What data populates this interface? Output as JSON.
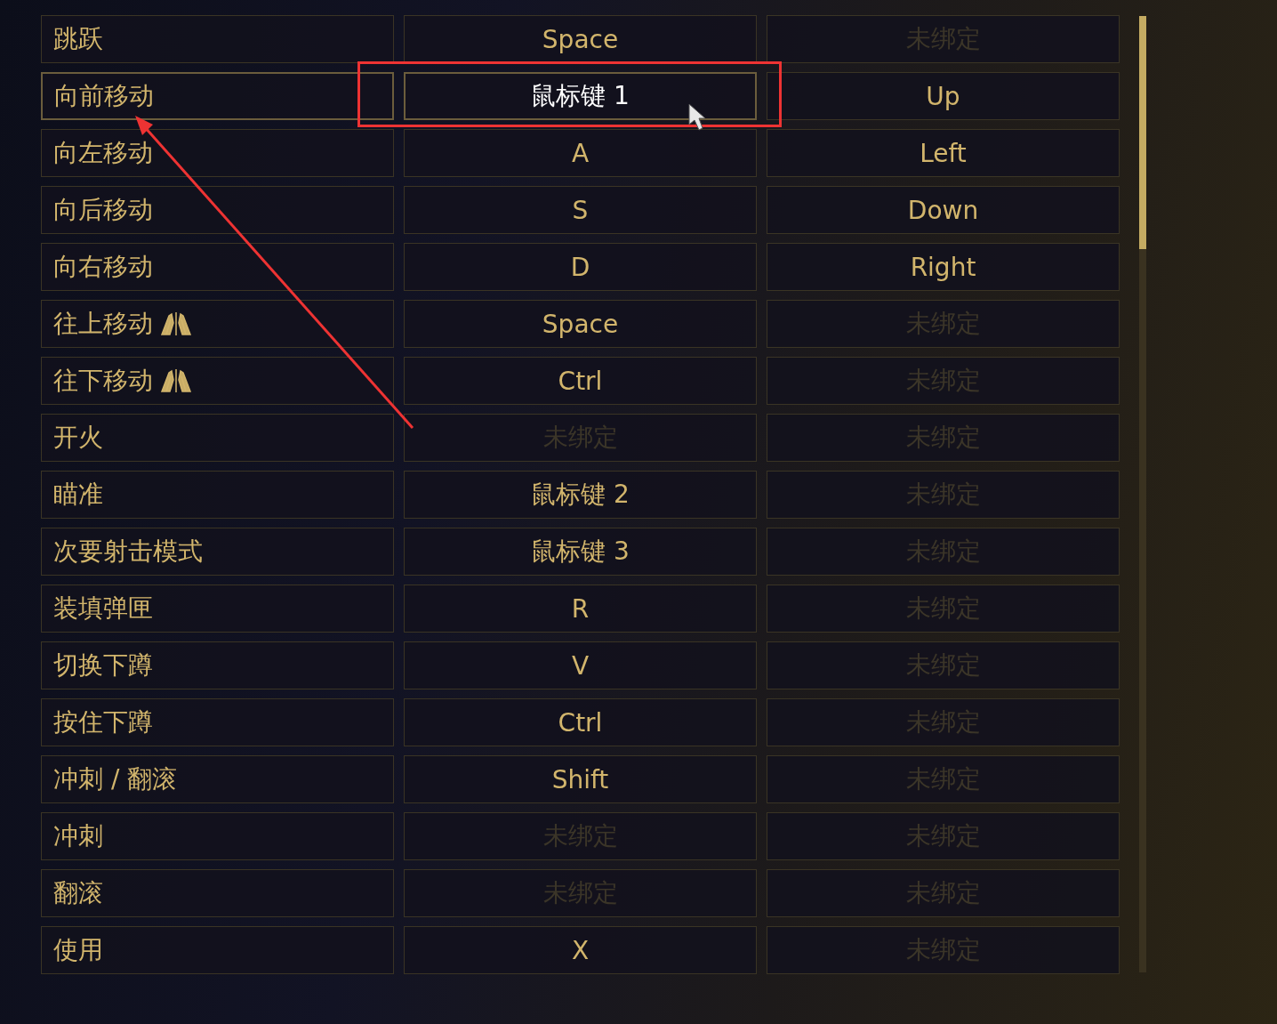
{
  "rows": [
    {
      "action": "跳跃",
      "hovered": false,
      "bindings": [
        {
          "label": "Space",
          "bound": true,
          "selected": false
        },
        {
          "label": "未绑定",
          "bound": false,
          "selected": false
        }
      ]
    },
    {
      "action": "向前移动",
      "hovered": true,
      "bindings": [
        {
          "label": "鼠标键 1",
          "bound": true,
          "selected": true
        },
        {
          "label": "Up",
          "bound": true,
          "selected": false
        }
      ]
    },
    {
      "action": "向左移动",
      "hovered": false,
      "bindings": [
        {
          "label": "A",
          "bound": true,
          "selected": false
        },
        {
          "label": "Left",
          "bound": true,
          "selected": false
        }
      ]
    },
    {
      "action": "向后移动",
      "hovered": false,
      "bindings": [
        {
          "label": "S",
          "bound": true,
          "selected": false
        },
        {
          "label": "Down",
          "bound": true,
          "selected": false
        }
      ]
    },
    {
      "action": "向右移动",
      "hovered": false,
      "bindings": [
        {
          "label": "D",
          "bound": true,
          "selected": false
        },
        {
          "label": "Right",
          "bound": true,
          "selected": false
        }
      ]
    },
    {
      "action": "往上移动",
      "kind": "flight",
      "hovered": false,
      "bindings": [
        {
          "label": "Space",
          "bound": true,
          "selected": false
        },
        {
          "label": "未绑定",
          "bound": false,
          "selected": false
        }
      ]
    },
    {
      "action": "往下移动",
      "kind": "flight",
      "hovered": false,
      "bindings": [
        {
          "label": "Ctrl",
          "bound": true,
          "selected": false
        },
        {
          "label": "未绑定",
          "bound": false,
          "selected": false
        }
      ]
    },
    {
      "action": "开火",
      "hovered": false,
      "bindings": [
        {
          "label": "未绑定",
          "bound": false,
          "selected": false
        },
        {
          "label": "未绑定",
          "bound": false,
          "selected": false
        }
      ]
    },
    {
      "action": "瞄准",
      "hovered": false,
      "bindings": [
        {
          "label": "鼠标键 2",
          "bound": true,
          "selected": false
        },
        {
          "label": "未绑定",
          "bound": false,
          "selected": false
        }
      ]
    },
    {
      "action": "次要射击模式",
      "hovered": false,
      "bindings": [
        {
          "label": "鼠标键 3",
          "bound": true,
          "selected": false
        },
        {
          "label": "未绑定",
          "bound": false,
          "selected": false
        }
      ]
    },
    {
      "action": "装填弹匣",
      "hovered": false,
      "bindings": [
        {
          "label": "R",
          "bound": true,
          "selected": false
        },
        {
          "label": "未绑定",
          "bound": false,
          "selected": false
        }
      ]
    },
    {
      "action": "切换下蹲",
      "hovered": false,
      "bindings": [
        {
          "label": "V",
          "bound": true,
          "selected": false
        },
        {
          "label": "未绑定",
          "bound": false,
          "selected": false
        }
      ]
    },
    {
      "action": "按住下蹲",
      "hovered": false,
      "bindings": [
        {
          "label": "Ctrl",
          "bound": true,
          "selected": false
        },
        {
          "label": "未绑定",
          "bound": false,
          "selected": false
        }
      ]
    },
    {
      "action": "冲刺 / 翻滚",
      "hovered": false,
      "bindings": [
        {
          "label": "Shift",
          "bound": true,
          "selected": false
        },
        {
          "label": "未绑定",
          "bound": false,
          "selected": false
        }
      ]
    },
    {
      "action": "冲刺",
      "hovered": false,
      "bindings": [
        {
          "label": "未绑定",
          "bound": false,
          "selected": false
        },
        {
          "label": "未绑定",
          "bound": false,
          "selected": false
        }
      ]
    },
    {
      "action": "翻滚",
      "hovered": false,
      "bindings": [
        {
          "label": "未绑定",
          "bound": false,
          "selected": false
        },
        {
          "label": "未绑定",
          "bound": false,
          "selected": false
        }
      ]
    },
    {
      "action": "使用",
      "hovered": false,
      "bindings": [
        {
          "label": "X",
          "bound": true,
          "selected": false
        },
        {
          "label": "未绑定",
          "bound": false,
          "selected": false
        }
      ]
    }
  ]
}
